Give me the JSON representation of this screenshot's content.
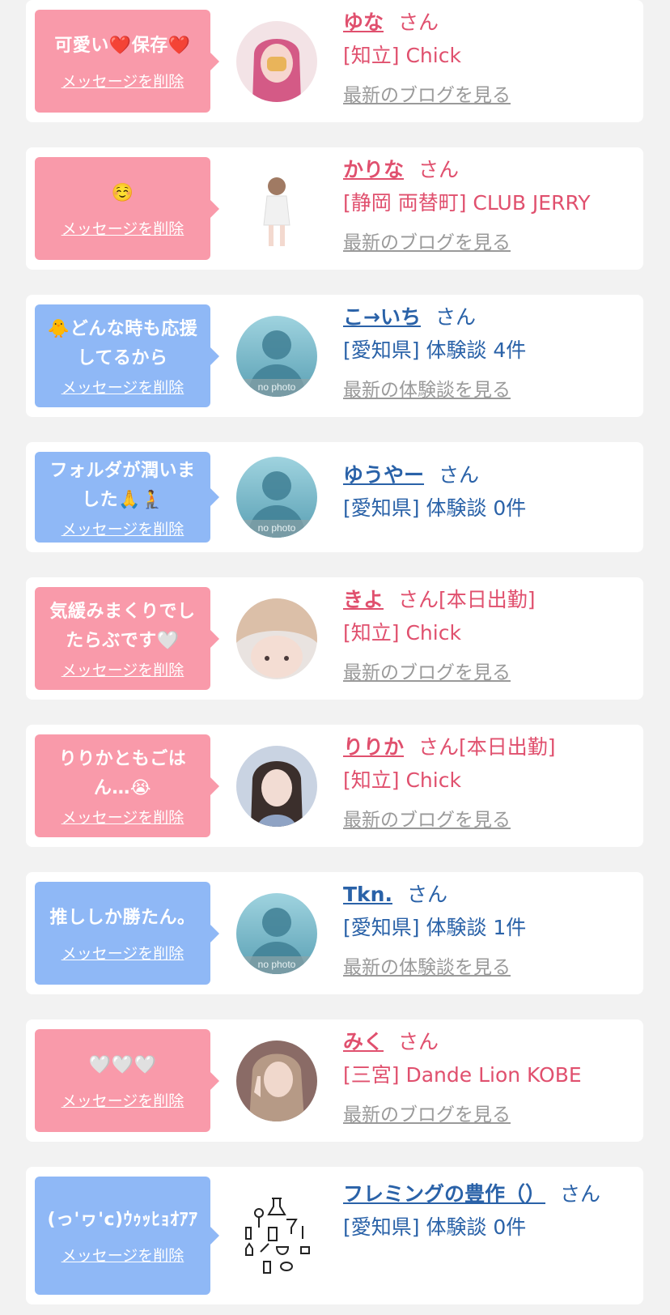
{
  "delete_label": "メッセージを削除",
  "san_label": "さん",
  "nophoto_label": "no photo",
  "colors": {
    "pink_bubble": "#f99aaa",
    "blue_bubble": "#8fb8f6",
    "pink_text": "#e0506e",
    "blue_text": "#2a62a8",
    "muted_link": "#9a9a9a",
    "background": "#f2f2f2"
  },
  "messages": [
    {
      "theme": "pink",
      "message": [
        "可愛い❤️保存❤️"
      ],
      "avatar": "photo-pink-hair",
      "name": "ゆな",
      "status": "",
      "place": "[知立] Chick",
      "latest": "最新のブログを見る"
    },
    {
      "theme": "pink",
      "message": [
        "☺️"
      ],
      "avatar": "photo-full-body",
      "name": "かりな",
      "status": "",
      "place": "[静岡 両替町] CLUB JERRY",
      "latest": "最新のブログを見る"
    },
    {
      "theme": "blue",
      "message": [
        "🐥どんな時も応援",
        "してるから"
      ],
      "avatar": "no-photo",
      "name": "こ→いち",
      "status": "",
      "place": "[愛知県] 体験談 4件",
      "latest": "最新の体験談を見る"
    },
    {
      "theme": "blue",
      "message": [
        "フォルダが潤いま",
        "した🙏🧎"
      ],
      "avatar": "no-photo",
      "name": "ゆうやー",
      "status": "",
      "place": "[愛知県] 体験談 0件",
      "latest": ""
    },
    {
      "theme": "pink",
      "message": [
        "気緩みまくりでし",
        "たらぶです🤍"
      ],
      "avatar": "photo-blonde",
      "name": "きよ",
      "status": "[本日出勤]",
      "place": "[知立] Chick",
      "latest": "最新のブログを見る"
    },
    {
      "theme": "pink",
      "message": [
        "りりかともごは",
        "ん…😭"
      ],
      "avatar": "photo-dark-hair",
      "name": "りりか",
      "status": "[本日出勤]",
      "place": "[知立] Chick",
      "latest": "最新のブログを見る"
    },
    {
      "theme": "blue",
      "message": [
        "推ししか勝たん。"
      ],
      "avatar": "no-photo",
      "name": "Tkn.",
      "status": "",
      "place": "[愛知県] 体験談 1件",
      "latest": "最新の体験談を見る"
    },
    {
      "theme": "pink",
      "message": [
        "🤍🤍🤍"
      ],
      "avatar": "photo-peace-sign",
      "name": "みく",
      "status": "",
      "place": "[三宮] Dande Lion KOBE",
      "latest": "最新のブログを見る"
    },
    {
      "theme": "blue",
      "message": [
        "(っ'ヮ'c)ｳｩｯﾋｮｵｱｱ"
      ],
      "avatar": "icon-lab-equipment",
      "name": "フレミングの豊作（）",
      "status": "",
      "place": "[愛知県] 体験談 0件",
      "latest": ""
    }
  ]
}
